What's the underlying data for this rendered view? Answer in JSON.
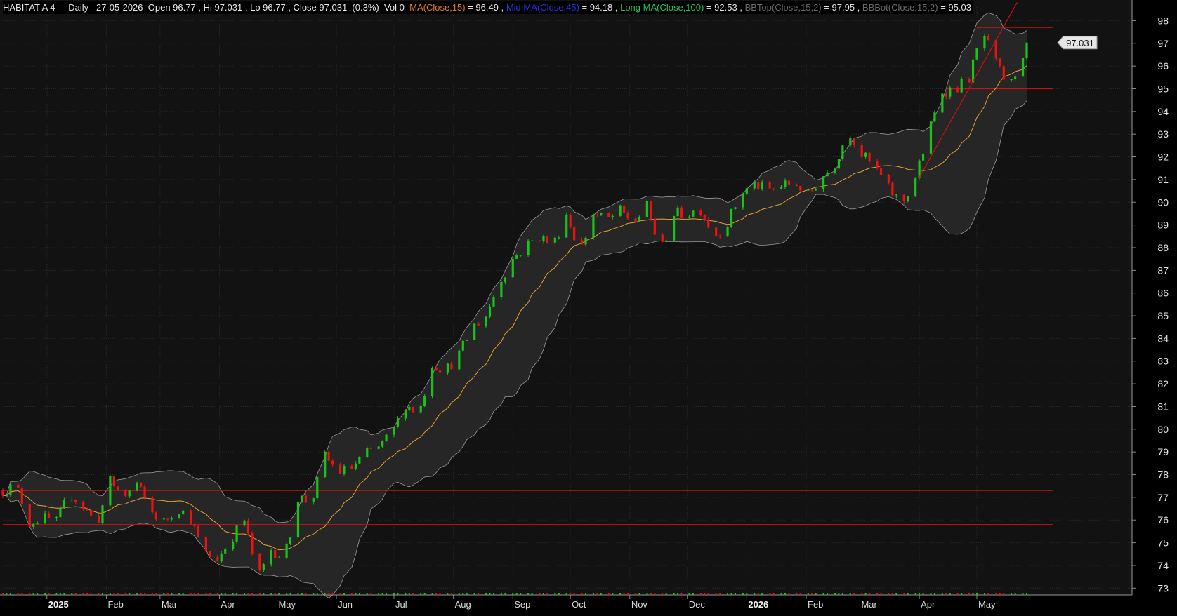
{
  "header": {
    "symbol": "HABITAT A 4",
    "period": "Daily",
    "date": "27-05-2026",
    "open": "96.77",
    "high": "97.031",
    "low": "96.77",
    "close": "97.031",
    "change": "(0.3%)",
    "volume": "0",
    "ma_label": "MA(Close,15)",
    "ma_value": "96.49",
    "mid_label": "Mid MA(Close,45)",
    "mid_value": "94.18",
    "long_label": "Long MA(Close,100)",
    "long_value": "92.53",
    "bbtop_label": "BBTop(Close,15,2)",
    "bbtop_value": "97.95",
    "bbbot_label": "BBBot(Close,15,2)",
    "bbbot_value": "95.03"
  },
  "colors": {
    "background": "#121212",
    "grid": "#2a2a2a",
    "up": "#18c418",
    "down": "#ee1111",
    "ma": "#e6a030",
    "bands": "#9a9a9a",
    "hline": "#cc1111",
    "trendline": "#cc1111",
    "axis_text": "#e6e6e6"
  },
  "chart_data": {
    "type": "candlestick",
    "title": "",
    "y_axis": {
      "position": "right",
      "ylim": [
        72.7,
        98.6
      ],
      "ticks": [
        73,
        74,
        75,
        76,
        77,
        78,
        79,
        80,
        81,
        82,
        83,
        84,
        85,
        86,
        87,
        88,
        89,
        90,
        91,
        92,
        93,
        94,
        95,
        96,
        97,
        98
      ]
    },
    "x_axis": {
      "start": "2024-12-09",
      "end": "2026-05-27",
      "labels": [
        {
          "date": "2025-01-01",
          "text": "2025",
          "year": true
        },
        {
          "date": "2025-02-01",
          "text": "Feb"
        },
        {
          "date": "2025-03-01",
          "text": "Mar"
        },
        {
          "date": "2025-04-01",
          "text": "Apr"
        },
        {
          "date": "2025-05-01",
          "text": "May"
        },
        {
          "date": "2025-06-01",
          "text": "Jun"
        },
        {
          "date": "2025-07-01",
          "text": "Jul"
        },
        {
          "date": "2025-08-01",
          "text": "Aug"
        },
        {
          "date": "2025-09-01",
          "text": "Sep"
        },
        {
          "date": "2025-10-01",
          "text": "Oct"
        },
        {
          "date": "2025-11-01",
          "text": "Nov"
        },
        {
          "date": "2025-12-01",
          "text": "Dec"
        },
        {
          "date": "2026-01-01",
          "text": "2026",
          "year": true
        },
        {
          "date": "2026-02-01",
          "text": "Feb"
        },
        {
          "date": "2026-03-01",
          "text": "Mar"
        },
        {
          "date": "2026-04-01",
          "text": "Apr"
        },
        {
          "date": "2026-05-01",
          "text": "May"
        }
      ]
    },
    "last_price": {
      "value": 97.031,
      "text": "97.031"
    },
    "price_path": [
      [
        "2024-12-09",
        77.3
      ],
      [
        "2024-12-16",
        77.5
      ],
      [
        "2024-12-23",
        75.9
      ],
      [
        "2024-12-30",
        76.1
      ],
      [
        "2025-01-06",
        75.9
      ],
      [
        "2025-01-13",
        77.2
      ],
      [
        "2025-01-20",
        76.6
      ],
      [
        "2025-01-27",
        75.8
      ],
      [
        "2025-02-03",
        77.7
      ],
      [
        "2025-02-10",
        77.0
      ],
      [
        "2025-02-17",
        77.6
      ],
      [
        "2025-02-24",
        76.4
      ],
      [
        "2025-03-03",
        75.9
      ],
      [
        "2025-03-10",
        76.6
      ],
      [
        "2025-03-17",
        76.0
      ],
      [
        "2025-03-24",
        74.5
      ],
      [
        "2025-03-31",
        74.3
      ],
      [
        "2025-04-07",
        75.2
      ],
      [
        "2025-04-14",
        76.0
      ],
      [
        "2025-04-21",
        73.4
      ],
      [
        "2025-04-28",
        74.7
      ],
      [
        "2025-05-05",
        74.3
      ],
      [
        "2025-05-12",
        77.0
      ],
      [
        "2025-05-19",
        76.8
      ],
      [
        "2025-05-26",
        78.8
      ],
      [
        "2025-06-02",
        78.1
      ],
      [
        "2025-06-09",
        78.3
      ],
      [
        "2025-06-16",
        78.9
      ],
      [
        "2025-06-23",
        79.2
      ],
      [
        "2025-06-30",
        79.8
      ],
      [
        "2025-07-07",
        81.1
      ],
      [
        "2025-07-14",
        80.7
      ],
      [
        "2025-07-21",
        82.9
      ],
      [
        "2025-07-28",
        82.6
      ],
      [
        "2025-08-04",
        83.3
      ],
      [
        "2025-08-11",
        84.5
      ],
      [
        "2025-08-18",
        85.0
      ],
      [
        "2025-08-25",
        86.5
      ],
      [
        "2025-09-01",
        87.5
      ],
      [
        "2025-09-08",
        88.1
      ],
      [
        "2025-09-15",
        88.5
      ],
      [
        "2025-09-22",
        88.1
      ],
      [
        "2025-09-29",
        89.5
      ],
      [
        "2025-10-06",
        87.8
      ],
      [
        "2025-10-13",
        89.5
      ],
      [
        "2025-10-20",
        89.2
      ],
      [
        "2025-10-27",
        89.6
      ],
      [
        "2025-11-03",
        89.1
      ],
      [
        "2025-11-10",
        89.8
      ],
      [
        "2025-11-17",
        87.8
      ],
      [
        "2025-11-24",
        89.5
      ],
      [
        "2025-12-01",
        89.5
      ],
      [
        "2025-12-08",
        89.7
      ],
      [
        "2025-12-15",
        88.5
      ],
      [
        "2025-12-22",
        89.1
      ],
      [
        "2025-12-29",
        90.4
      ],
      [
        "2026-01-05",
        90.8
      ],
      [
        "2026-01-12",
        90.5
      ],
      [
        "2026-01-19",
        90.7
      ],
      [
        "2026-01-26",
        90.9
      ],
      [
        "2026-02-02",
        90.3
      ],
      [
        "2026-02-09",
        91.1
      ],
      [
        "2026-02-16",
        91.7
      ],
      [
        "2026-02-23",
        93.2
      ],
      [
        "2026-03-02",
        92.1
      ],
      [
        "2026-03-09",
        91.5
      ],
      [
        "2026-03-16",
        90.6
      ],
      [
        "2026-03-23",
        89.9
      ],
      [
        "2026-03-30",
        91.1
      ],
      [
        "2026-04-06",
        93.1
      ],
      [
        "2026-04-13",
        94.9
      ],
      [
        "2026-04-20",
        95.0
      ],
      [
        "2026-04-27",
        95.5
      ],
      [
        "2026-05-04",
        97.5
      ],
      [
        "2026-05-11",
        96.1
      ],
      [
        "2026-05-18",
        95.0
      ],
      [
        "2026-05-27",
        97.031
      ]
    ],
    "moving_averages": [
      {
        "name": "MA(Close,15)",
        "period": 15
      }
    ],
    "bollinger": {
      "name": "BB(Close,15,2)",
      "period": 15,
      "stdev": 2
    },
    "horizontal_lines": [
      {
        "value": 77.3,
        "start": "2024-12-09",
        "end": "2026-05-27"
      },
      {
        "value": 75.8,
        "start": "2024-12-09",
        "end": "2026-05-27"
      },
      {
        "value": 97.7,
        "start": "2026-05-01",
        "end": "2026-05-27"
      },
      {
        "value": 95.0,
        "start": "2026-04-15",
        "end": "2026-05-27"
      }
    ],
    "trendline": {
      "start": [
        "2026-04-01",
        91.1
      ],
      "end": [
        "2026-05-22",
        98.8
      ]
    },
    "grid": true,
    "legend": "top-left"
  }
}
